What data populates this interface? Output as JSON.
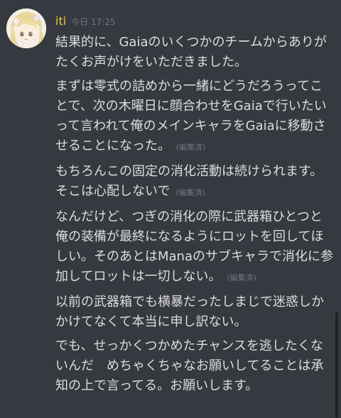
{
  "message": {
    "username": "iti",
    "timestamp": "今日 17:25",
    "edited_label": "(編集済)",
    "paragraphs": [
      "結果的に、Gaiaのいくつかのチームからありがたくお声がけをいただきました。",
      "まずは零式の詰めから一緒にどうだろうってことで、次の木曜日に顔合わせをGaiaで行いたいって言われて俺のメインキャラをGaiaに移動させることになった。",
      "もちろんこの固定の消化活動は続けられます。そこは心配しないで",
      "なんだけど、つぎの消化の際に武器箱ひとつと俺の装備が最終になるようにロットを回してほしい。そのあとはManaのサブキャラで消化に参加してロットは一切しない。",
      "以前の武器箱でも横暴だったしまじで迷惑しかかけてなくて本当に申し訳ない。",
      "でも、せっかくつかめたチャンスを逃したくないんだ　めちゃくちゃなお願いしてることは承知の上で言ってる。お願いします。"
    ]
  },
  "colors": {
    "background": "#36393f",
    "username": "#f0c93a",
    "text": "#dcddde",
    "muted": "#72767d"
  },
  "icons": {
    "avatar": "anime-avatar-icon"
  }
}
